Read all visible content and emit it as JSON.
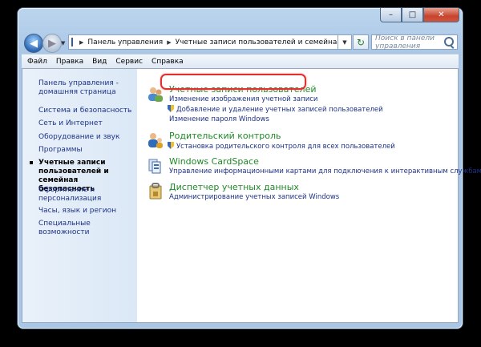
{
  "window": {
    "caption_buttons": {
      "min": "–",
      "max": "□",
      "close": "✕"
    }
  },
  "nav": {
    "back_icon": "◀",
    "forward_icon": "▶",
    "dropdown": "▼",
    "breadcrumb": [
      "Панель управления",
      "Учетные записи пользователей и семейная безопасность"
    ],
    "search_placeholder": "Поиск в панели управления",
    "refresh_icon": "↻"
  },
  "menu": [
    "Файл",
    "Правка",
    "Вид",
    "Сервис",
    "Справка"
  ],
  "left_pane": {
    "items": [
      "Панель управления - домашняя страница",
      "Система и безопасность",
      "Сеть и Интернет",
      "Оборудование и звук",
      "Программы",
      "Учетные записи пользователей и семейная безопасность",
      "Оформление и персонализация",
      "Часы, язык и регион",
      "Специальные возможности"
    ],
    "active_index": 5
  },
  "categories": [
    {
      "title": "Учетные записи пользователей",
      "links": [
        "Изменение изображения учетной записи",
        "Добавление и удаление учетных записей пользователей",
        "Изменение пароля Windows"
      ],
      "shield": [
        false,
        true,
        false
      ],
      "icon": "users-icon"
    },
    {
      "title": "Родительский контроль",
      "links": [
        "Установка родительского контроля для всех пользователей"
      ],
      "shield": [
        true
      ],
      "icon": "parental-control-icon"
    },
    {
      "title": "Windows CardSpace",
      "links": [
        "Управление информационными картами для подключения к интерактивным службам"
      ],
      "shield": [
        false
      ],
      "icon": "cardspace-icon"
    },
    {
      "title": "Диспетчер учетных данных",
      "links": [
        "Администрирование учетных записей Windows"
      ],
      "shield": [
        false
      ],
      "icon": "credential-manager-icon"
    }
  ],
  "colors": {
    "accent_link": "#1e3287",
    "category_title": "#1e8a26",
    "highlight": "#e03030"
  }
}
